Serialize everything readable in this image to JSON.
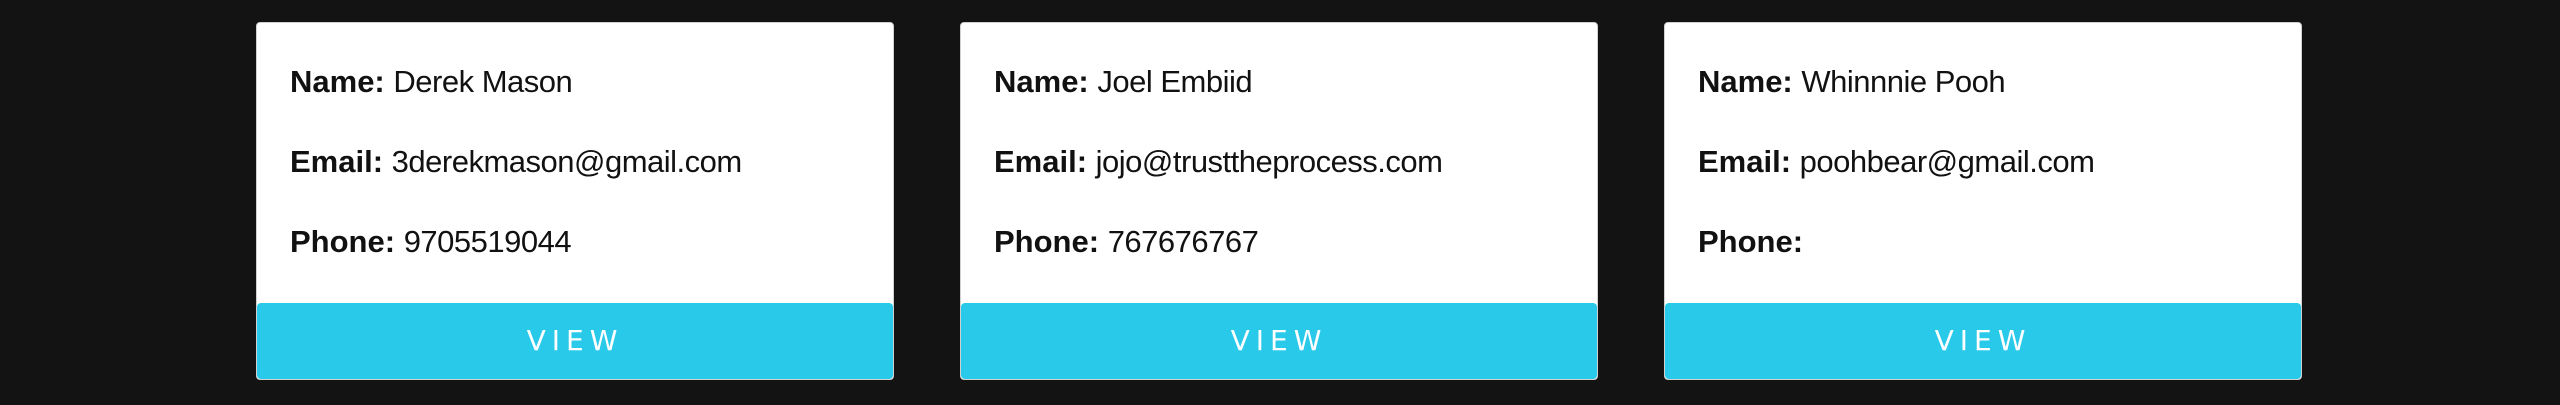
{
  "contacts": [
    {
      "name_label": "Name:",
      "name": "Derek Mason",
      "email_label": "Email:",
      "email": "3derekmason@gmail.com",
      "phone_label": "Phone:",
      "phone": "9705519044",
      "view_label": "VIEW"
    },
    {
      "name_label": "Name:",
      "name": "Joel Embiid",
      "email_label": "Email:",
      "email": "jojo@trusttheprocess.com",
      "phone_label": "Phone:",
      "phone": "767676767",
      "view_label": "VIEW"
    },
    {
      "name_label": "Name:",
      "name": "Whinnnie Pooh",
      "email_label": "Email:",
      "email": "poohbear@gmail.com",
      "phone_label": "Phone:",
      "phone": "",
      "view_label": "VIEW"
    }
  ],
  "colors": {
    "background": "#131313",
    "card": "#ffffff",
    "button": "#29c9ea",
    "button_text": "#ffffff"
  }
}
